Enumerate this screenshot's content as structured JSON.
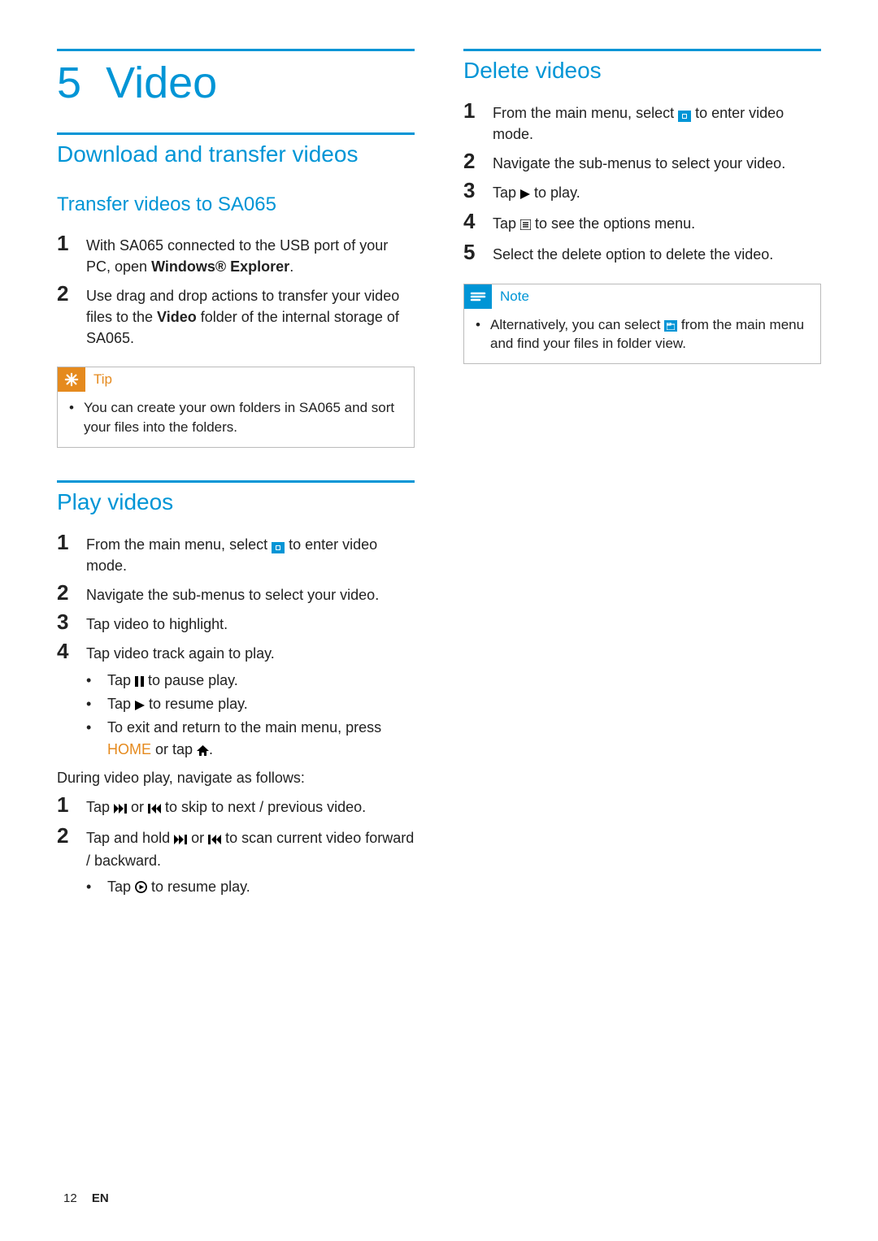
{
  "chapter": {
    "num": "5",
    "title": "Video"
  },
  "left": {
    "h2a": "Download and transfer videos",
    "h3a": "Transfer videos to SA065",
    "transfer_steps": [
      {
        "n": "1",
        "pre": "With SA065 connected to the USB port of your PC, open ",
        "bold": "Windows® Explorer",
        "post": "."
      },
      {
        "n": "2",
        "pre": "Use drag and drop actions to transfer your video files to the ",
        "bold": "Video",
        "post": " folder of the internal storage of SA065."
      }
    ],
    "tip": {
      "label": "Tip",
      "items": [
        "You can create your own folders in SA065 and sort your files into the folders."
      ]
    },
    "h2b": "Play videos",
    "play_steps": [
      {
        "n": "1",
        "pre": "From the main menu, select ",
        "icon": "video-mode",
        "post": " to enter video mode."
      },
      {
        "n": "2",
        "text": "Navigate the sub-menus to select your video."
      },
      {
        "n": "3",
        "text": "Tap video to highlight."
      },
      {
        "n": "4",
        "text": "Tap video track again to play."
      }
    ],
    "play_subs": [
      {
        "pre": "Tap ",
        "icon": "pause",
        "post": " to pause play."
      },
      {
        "pre": "Tap ",
        "icon": "play",
        "post": " to resume play."
      },
      {
        "pre": "To exit and return to the main menu, press ",
        "home": "HOME",
        "post2": " or tap ",
        "icon": "home-icon",
        "post3": "."
      }
    ],
    "during_label": "During video play, navigate as follows:",
    "during_steps": [
      {
        "n": "1",
        "pre": "Tap ",
        "i1": "next",
        "mid": " or ",
        "i2": "prev",
        "post": " to skip to next / previous video."
      },
      {
        "n": "2",
        "pre": "Tap and hold ",
        "i1": "next",
        "mid": " or ",
        "i2": "prev",
        "post": " to scan current video forward / backward."
      }
    ],
    "during_sub": {
      "pre": "Tap ",
      "icon": "play-circle",
      "post": " to resume play."
    }
  },
  "right": {
    "h2": "Delete videos",
    "steps": [
      {
        "n": "1",
        "pre": "From the main menu, select ",
        "icon": "video-mode",
        "post": " to enter video mode."
      },
      {
        "n": "2",
        "text": "Navigate the sub-menus to select your video."
      },
      {
        "n": "3",
        "pre": "Tap ",
        "icon": "play",
        "post": " to play."
      },
      {
        "n": "4",
        "pre": "Tap ",
        "icon": "options",
        "post": " to see the options menu."
      },
      {
        "n": "5",
        "text": "Select the delete option to delete the video."
      }
    ],
    "note": {
      "label": "Note",
      "pre": "Alternatively, you can select ",
      "icon": "folder",
      "post": " from the main menu and find your files in folder view."
    }
  },
  "footer": {
    "page": "12",
    "lang": "EN"
  }
}
